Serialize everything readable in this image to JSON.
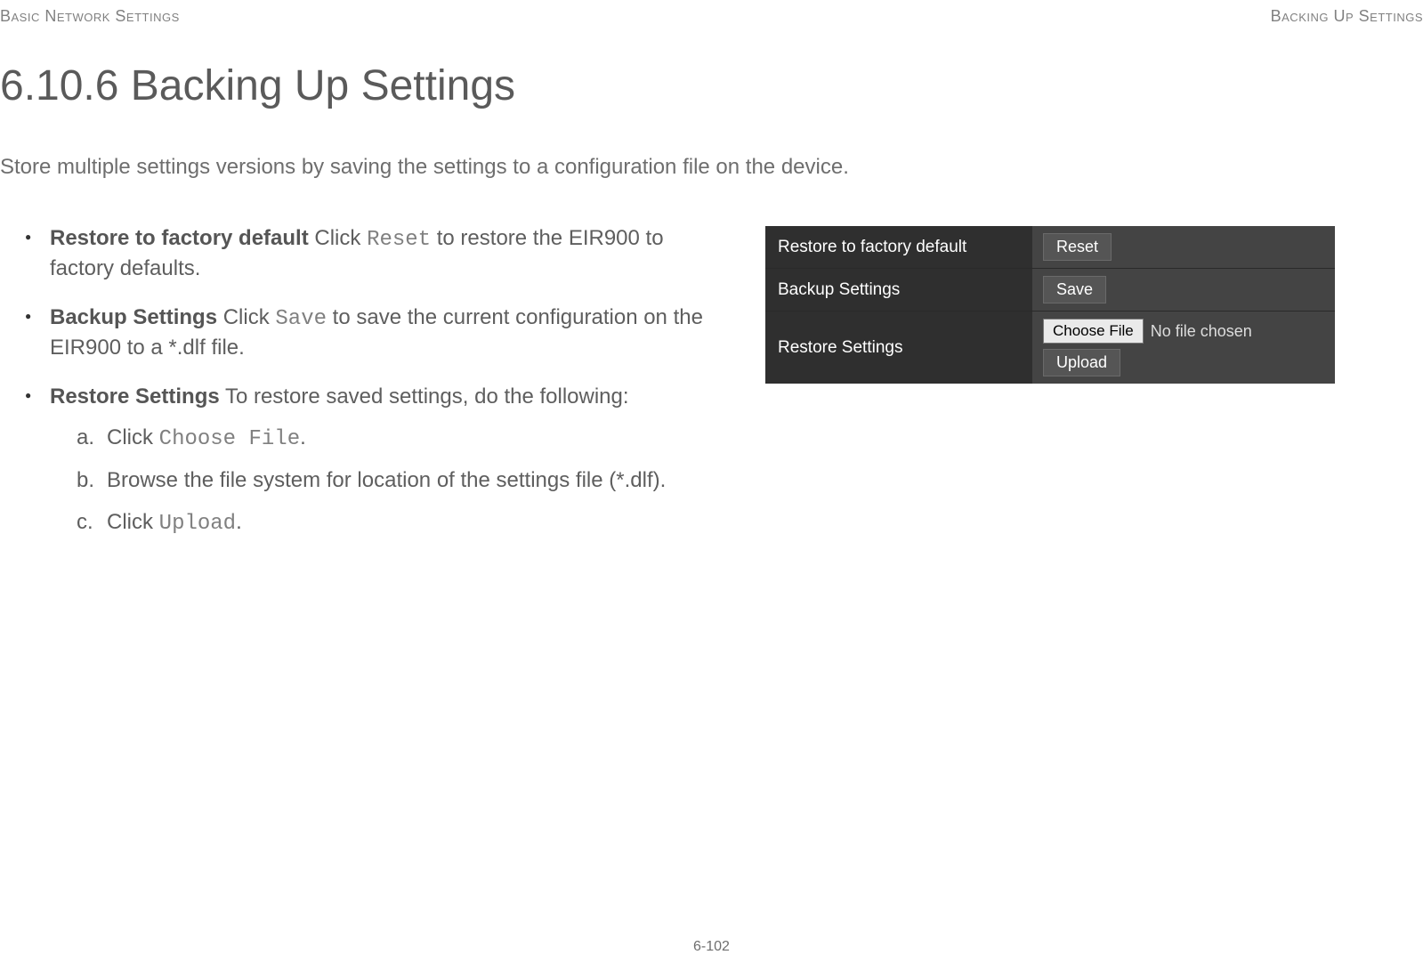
{
  "header": {
    "left": "Basic Network Settings",
    "right": "Backing Up Settings"
  },
  "title": "6.10.6 Backing Up Settings",
  "intro": "Store multiple settings versions by saving the settings to a configuration file on the device.",
  "bullets": {
    "restore_default": {
      "label": "Restore to factory default",
      "text_before": "  Click ",
      "code": "Reset",
      "text_after": " to restore the EIR900 to factory defaults."
    },
    "backup": {
      "label": "Backup Settings",
      "text_before": "  Click ",
      "code": "Save",
      "text_after": " to save the current configu­ration on the EIR900 to a *.dlf file."
    },
    "restore_settings": {
      "label": "Restore Settings",
      "text": "  To restore saved settings, do the fol­lowing:"
    }
  },
  "steps": {
    "a": {
      "before": "Click ",
      "code": "Choose File",
      "after": "."
    },
    "b": "Browse the file system for location of the settings file (*.dlf).",
    "c": {
      "before": "Click ",
      "code": "Upload",
      "after": "."
    }
  },
  "panel": {
    "rows": {
      "restore": {
        "label": "Restore to factory default",
        "button": "Reset"
      },
      "backup": {
        "label": "Backup Settings",
        "button": "Save"
      },
      "restore_settings": {
        "label": "Restore Settings",
        "choose": "Choose File",
        "nofile": "No file chosen",
        "upload": "Upload"
      }
    }
  },
  "page_number": "6-102"
}
